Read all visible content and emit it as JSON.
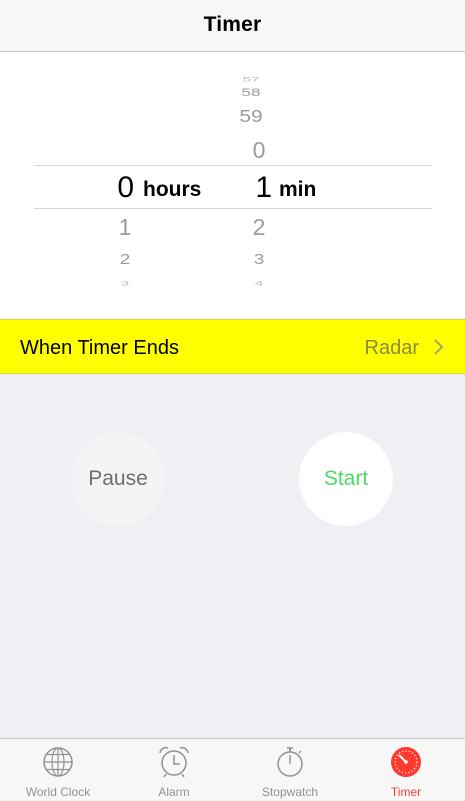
{
  "navbar": {
    "title": "Timer"
  },
  "picker": {
    "hours": {
      "selected": "0",
      "unit": "hours",
      "below": [
        "1",
        "2",
        "3"
      ]
    },
    "minutes": {
      "above": [
        "57",
        "58",
        "59",
        "0"
      ],
      "selected": "1",
      "unit": "min",
      "below": [
        "2",
        "3",
        "4"
      ]
    }
  },
  "timer_ends": {
    "label": "When Timer Ends",
    "value": "Radar"
  },
  "buttons": {
    "pause": "Pause",
    "start": "Start"
  },
  "tabs": [
    {
      "label": "World Clock",
      "icon": "globe-icon",
      "active": false
    },
    {
      "label": "Alarm",
      "icon": "alarm-clock-icon",
      "active": false
    },
    {
      "label": "Stopwatch",
      "icon": "stopwatch-icon",
      "active": false
    },
    {
      "label": "Timer",
      "icon": "timer-icon",
      "active": true
    }
  ],
  "colors": {
    "highlight": "#ffff00",
    "start_green": "#4cd964",
    "active_tab": "#ff3b30",
    "inactive_tab": "#929292"
  }
}
